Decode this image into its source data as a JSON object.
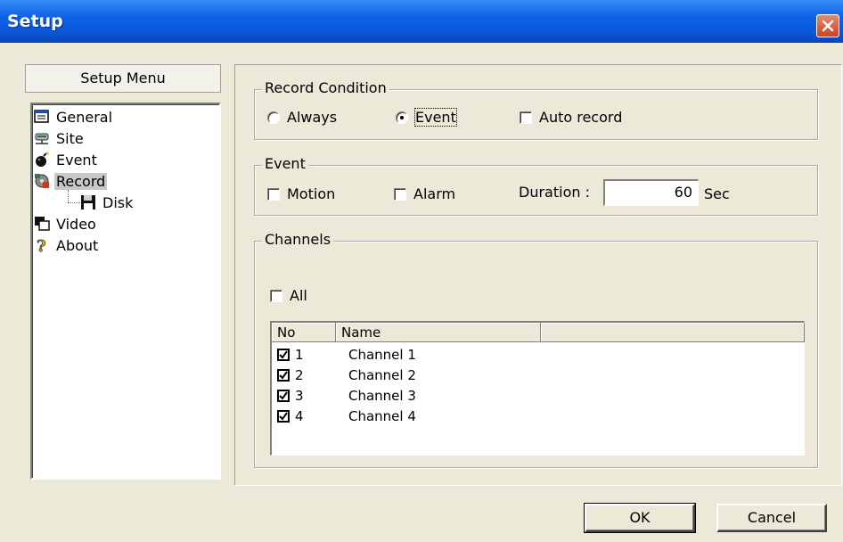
{
  "window": {
    "title": "Setup"
  },
  "sidebar": {
    "header": "Setup Menu",
    "items": [
      {
        "label": "General",
        "icon": "properties-icon"
      },
      {
        "label": "Site",
        "icon": "network-drive-icon"
      },
      {
        "label": "Event",
        "icon": "bomb-icon"
      },
      {
        "label": "Record",
        "icon": "record-film-icon",
        "selected": true
      },
      {
        "label": "Disk",
        "icon": "floppy-disk-icon",
        "child": true
      },
      {
        "label": "Video",
        "icon": "video-windows-icon"
      },
      {
        "label": "About",
        "icon": "question-mark-icon"
      }
    ]
  },
  "record_condition": {
    "legend": "Record Condition",
    "always_label": "Always",
    "event_label": "Event",
    "auto_record_label": "Auto record",
    "selected": "Event",
    "auto_record_checked": false
  },
  "event": {
    "legend": "Event",
    "motion_label": "Motion",
    "alarm_label": "Alarm",
    "duration_label": "Duration :",
    "duration_value": "60",
    "duration_unit": "Sec"
  },
  "channels": {
    "legend": "Channels",
    "all_label": "All",
    "columns": [
      "No",
      "Name"
    ],
    "rows": [
      {
        "no": "1",
        "name": "Channel 1",
        "checked": true
      },
      {
        "no": "2",
        "name": "Channel 2",
        "checked": true
      },
      {
        "no": "3",
        "name": "Channel 3",
        "checked": true
      },
      {
        "no": "4",
        "name": "Channel 4",
        "checked": true
      }
    ]
  },
  "buttons": {
    "ok": "OK",
    "cancel": "Cancel"
  }
}
